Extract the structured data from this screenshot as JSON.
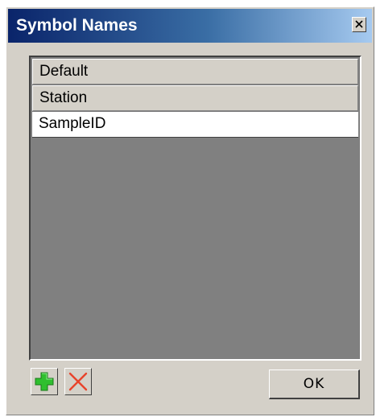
{
  "dialog": {
    "title": "Symbol Names"
  },
  "list": {
    "items": [
      {
        "label": "Default",
        "style": "header"
      },
      {
        "label": "Station",
        "style": "header"
      },
      {
        "label": "SampleID",
        "style": "item"
      }
    ]
  },
  "buttons": {
    "ok_label": "OK",
    "add_icon": "plus-icon",
    "delete_icon": "x-icon",
    "close_icon": "close-icon"
  },
  "colors": {
    "title_gradient_start": "#0a246a",
    "title_gradient_end": "#a6caf0",
    "window_face": "#d4d0c8",
    "list_background": "#808080",
    "add_icon_color": "#2fbf2f",
    "delete_icon_color": "#e8432a"
  }
}
